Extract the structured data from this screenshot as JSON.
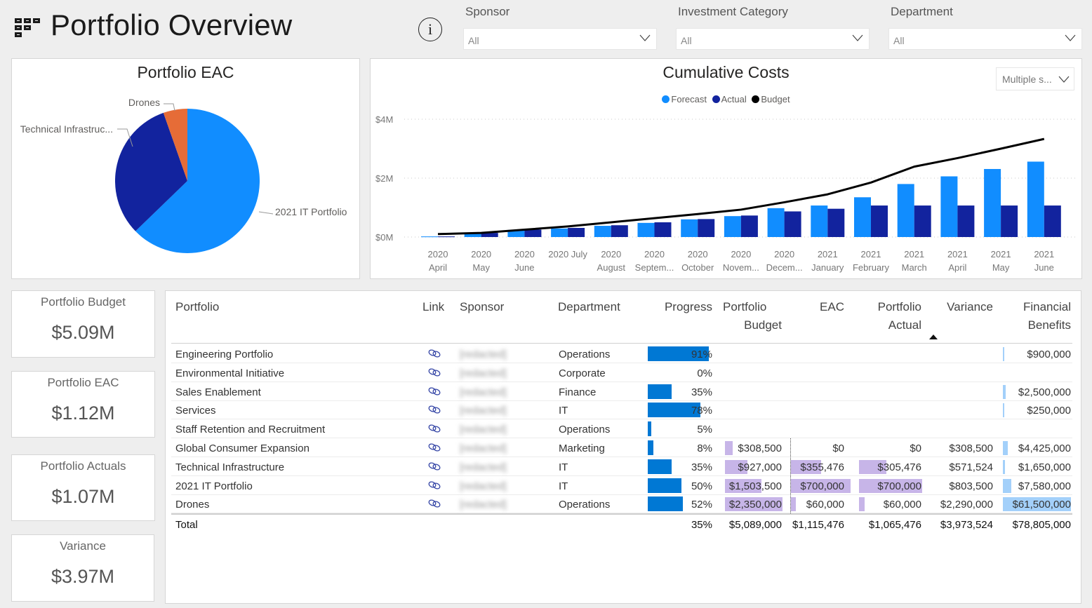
{
  "header": {
    "title": "Portfolio Overview",
    "app_icon": "grid-menu-icon",
    "info_icon": "info-icon",
    "info_glyph": "i"
  },
  "filters": [
    {
      "label": "Sponsor",
      "value": "All"
    },
    {
      "label": "Investment Category",
      "value": "All"
    },
    {
      "label": "Department",
      "value": "All"
    }
  ],
  "colors": {
    "forecast": "#118dff",
    "actual": "#12239e",
    "budget": "#000000",
    "drones": "#e66c37",
    "progress_bar": "#0078d4",
    "data_bar": "#c7b5e8",
    "benefits_bar": "#a3d0fa"
  },
  "pie": {
    "title": "Portfolio EAC",
    "chart_data": {
      "type": "pie",
      "title": "Portfolio EAC",
      "slices": [
        {
          "label": "2021 IT Portfolio",
          "value": 700000,
          "color": "#118dff"
        },
        {
          "label": "Technical Infrastruc...",
          "full_label": "Technical Infrastructure",
          "value": 355476,
          "color": "#12239e"
        },
        {
          "label": "Drones",
          "value": 60000,
          "color": "#e66c37"
        }
      ]
    }
  },
  "chart_data": {
    "type": "bar",
    "title": "Cumulative Costs",
    "legend": [
      "Forecast",
      "Actual",
      "Budget"
    ],
    "legend_position": "top-center",
    "categories": [
      [
        "2020",
        "April"
      ],
      [
        "2020",
        "May"
      ],
      [
        "2020",
        "June"
      ],
      [
        "2020 July",
        ""
      ],
      [
        "2020",
        "August"
      ],
      [
        "2020",
        "Septem..."
      ],
      [
        "2020",
        "October"
      ],
      [
        "2020",
        "Novem..."
      ],
      [
        "2020",
        "Decem..."
      ],
      [
        "2021",
        "January"
      ],
      [
        "2021",
        "February"
      ],
      [
        "2021",
        "March"
      ],
      [
        "2021",
        "April"
      ],
      [
        "2021",
        "May"
      ],
      [
        "2021",
        "June"
      ]
    ],
    "series": [
      {
        "name": "Forecast",
        "type": "bar",
        "values": [
          0.02,
          0.14,
          0.24,
          0.29,
          0.38,
          0.48,
          0.6,
          0.71,
          0.98,
          1.07,
          1.35,
          1.8,
          2.06,
          2.31,
          2.56
        ]
      },
      {
        "name": "Actual",
        "type": "bar",
        "values": [
          0.02,
          0.14,
          0.25,
          0.31,
          0.4,
          0.5,
          0.61,
          0.73,
          0.87,
          0.96,
          1.07,
          1.07,
          1.07,
          1.07,
          1.07
        ]
      },
      {
        "name": "Budget",
        "type": "line",
        "values": [
          0.1,
          0.14,
          0.25,
          0.36,
          0.5,
          0.64,
          0.78,
          0.93,
          1.18,
          1.45,
          1.85,
          2.39,
          2.68,
          3.0,
          3.33
        ]
      }
    ],
    "yticks": [
      "$0M",
      "$2M",
      "$4M"
    ],
    "ylim": [
      0,
      4
    ],
    "yunit": "$M",
    "grid": true,
    "slicer_value": "Multiple s..."
  },
  "kpis": [
    {
      "label": "Portfolio Budget",
      "value": "$5.09M"
    },
    {
      "label": "Portfolio EAC",
      "value": "$1.12M"
    },
    {
      "label": "Portfolio Actuals",
      "value": "$1.07M"
    },
    {
      "label": "Variance",
      "value": "$3.97M"
    }
  ],
  "table": {
    "columns": {
      "portfolio": "Portfolio",
      "link": "Link",
      "sponsor": "Sponsor",
      "department": "Department",
      "progress": "Progress",
      "budget_1": "Portfolio",
      "budget_2": "Budget",
      "eac": "EAC",
      "actual_1": "Portfolio",
      "actual_2": "Actual",
      "variance": "Variance",
      "benefits_1": "Financial",
      "benefits_2": "Benefits"
    },
    "sorted_column": "Portfolio Actual",
    "sort_direction": "ascending",
    "rows": [
      {
        "portfolio": "Engineering Portfolio",
        "sponsor": "[redacted]",
        "department": "Operations",
        "progress": "91%",
        "progress_value": 0.91,
        "budget": "",
        "budget_value": 0,
        "eac": "",
        "eac_value": 0,
        "actual": "",
        "actual_value": 0,
        "variance": "",
        "benefits": "$900,000",
        "benefits_value": 900000
      },
      {
        "portfolio": "Environmental Initiative",
        "sponsor": "[redacted]",
        "department": "Corporate",
        "progress": "0%",
        "progress_value": 0,
        "budget": "",
        "budget_value": 0,
        "eac": "",
        "eac_value": 0,
        "actual": "",
        "actual_value": 0,
        "variance": "",
        "benefits": "",
        "benefits_value": 0
      },
      {
        "portfolio": "Sales Enablement",
        "sponsor": "[redacted]",
        "department": "Finance",
        "progress": "35%",
        "progress_value": 0.35,
        "budget": "",
        "budget_value": 0,
        "eac": "",
        "eac_value": 0,
        "actual": "",
        "actual_value": 0,
        "variance": "",
        "benefits": "$2,500,000",
        "benefits_value": 2500000
      },
      {
        "portfolio": "Services",
        "sponsor": "[redacted]",
        "department": "IT",
        "progress": "78%",
        "progress_value": 0.78,
        "budget": "",
        "budget_value": 0,
        "eac": "",
        "eac_value": 0,
        "actual": "",
        "actual_value": 0,
        "variance": "",
        "benefits": "$250,000",
        "benefits_value": 250000
      },
      {
        "portfolio": "Staff Retention and Recruitment",
        "sponsor": "[redacted]",
        "department": "Operations",
        "progress": "5%",
        "progress_value": 0.05,
        "budget": "",
        "budget_value": 0,
        "eac": "",
        "eac_value": 0,
        "actual": "",
        "actual_value": 0,
        "variance": "",
        "benefits": "",
        "benefits_value": 0
      },
      {
        "portfolio": "Global Consumer Expansion",
        "sponsor": "[redacted]",
        "department": "Marketing",
        "progress": "8%",
        "progress_value": 0.08,
        "budget": "$308,500",
        "budget_value": 308500,
        "eac": "$0",
        "eac_value": 0,
        "actual": "$0",
        "actual_value": 0,
        "variance": "$308,500",
        "benefits": "$4,425,000",
        "benefits_value": 4425000
      },
      {
        "portfolio": "Technical Infrastructure",
        "sponsor": "[redacted]",
        "department": "IT",
        "progress": "35%",
        "progress_value": 0.35,
        "budget": "$927,000",
        "budget_value": 927000,
        "eac": "$355,476",
        "eac_value": 355476,
        "actual": "$305,476",
        "actual_value": 305476,
        "variance": "$571,524",
        "benefits": "$1,650,000",
        "benefits_value": 1650000
      },
      {
        "portfolio": "2021 IT Portfolio",
        "sponsor": "[redacted]",
        "department": "IT",
        "progress": "50%",
        "progress_value": 0.5,
        "budget": "$1,503,500",
        "budget_value": 1503500,
        "eac": "$700,000",
        "eac_value": 700000,
        "actual": "$700,000",
        "actual_value": 700000,
        "variance": "$803,500",
        "benefits": "$7,580,000",
        "benefits_value": 7580000
      },
      {
        "portfolio": "Drones",
        "sponsor": "[redacted]",
        "department": "Operations",
        "progress": "52%",
        "progress_value": 0.52,
        "budget": "$2,350,000",
        "budget_value": 2350000,
        "eac": "$60,000",
        "eac_value": 60000,
        "actual": "$60,000",
        "actual_value": 60000,
        "variance": "$2,290,000",
        "benefits": "$61,500,000",
        "benefits_value": 61500000
      }
    ],
    "total": {
      "label": "Total",
      "progress": "35%",
      "budget": "$5,089,000",
      "eac": "$1,115,476",
      "actual": "$1,065,476",
      "variance": "$3,973,524",
      "benefits": "$78,805,000"
    }
  }
}
